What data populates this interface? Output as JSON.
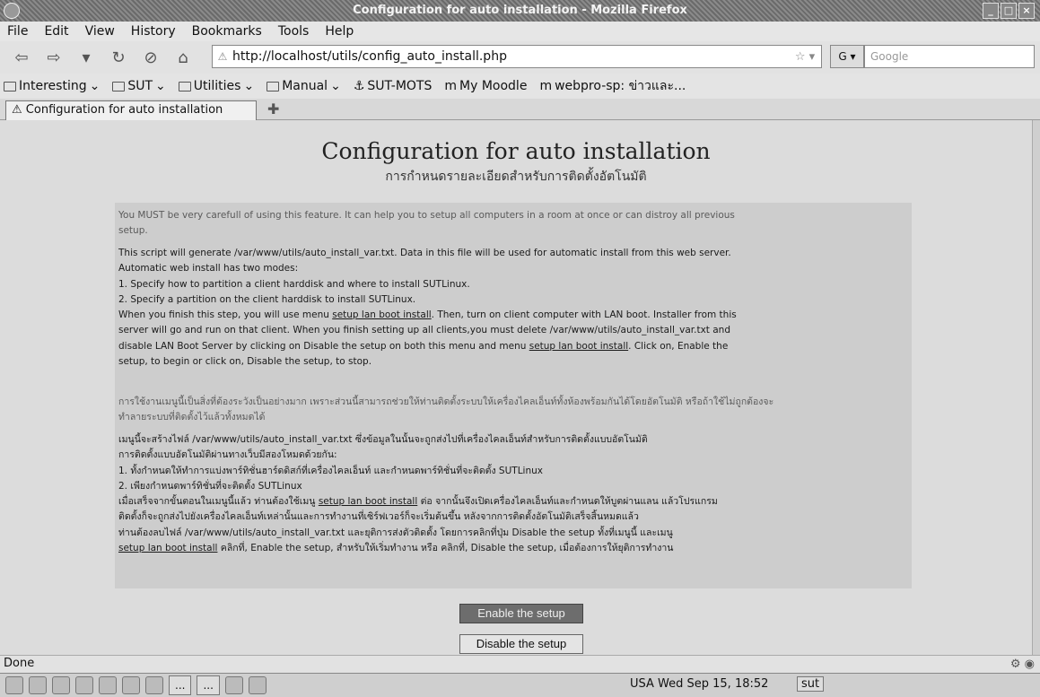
{
  "window": {
    "title": "Configuration for auto installation - Mozilla Firefox"
  },
  "menu": [
    "File",
    "Edit",
    "View",
    "History",
    "Bookmarks",
    "Tools",
    "Help"
  ],
  "nav": {
    "url": "http://localhost/utils/config_auto_install.php",
    "search_placeholder": "Google"
  },
  "bookmarks": [
    "Interesting",
    "SUT",
    "Utilities",
    "Manual",
    "SUT-MOTS",
    "My Moodle",
    "webpro-sp: ข่าวและ..."
  ],
  "tab": {
    "title": "Configuration for auto installation"
  },
  "page": {
    "title": "Configuration for auto installation",
    "subtitle": "การกำหนดรายละเอียดสำหรับการติดตั้งอัตโนมัติ",
    "warning": [
      "You MUST be very carefull of using this feature. It can help you to setup all computers in a room at once or can distroy all previous",
      "setup."
    ],
    "desc_lines": [
      "This script will generate /var/www/utils/auto_install_var.txt. Data in this file will be used for automatic install from this web server.",
      "Automatic web install has two modes:",
      "1. Specify how to partition a client harddisk and where to install SUTLinux.",
      "2. Specify a partition on the client harddisk to install SUTLinux."
    ],
    "desc_link_pre": "When you finish this step, you will use menu ",
    "desc_link_text": "setup lan boot install",
    "desc_link_post": ". Then, turn on client computer with LAN boot. Installer from this",
    "desc_line_6": "server will go and run on that client. When you finish setting up all clients,you must delete /var/www/utils/auto_install_var.txt and",
    "desc_line_7_pre": "disable LAN Boot Server by clicking on Disable the setup on both this menu and menu ",
    "desc_line_7_link": "setup lan boot install",
    "desc_line_7_post": ". Click on, Enable the",
    "desc_line_8": "setup, to begin or click on, Disable the setup, to stop.",
    "thai_warning": [
      "การใช้งานเมนูนี้เป็นสิ่งที่ต้องระวังเป็นอย่างมาก เพราะส่วนนี้สามารถช่วยให้ท่านติดตั้งระบบให้เครื่องไคลเอ็นท์ทั้งห้องพร้อมกันได้โดยอัตโนมัติ หรือถ้าใช้ไม่ถูกต้องจะ",
      "ทำลายระบบที่ติดตั้งไว้แล้วทั้งหมดได้"
    ],
    "thai_lines": [
      "เมนูนี้จะสร้างไฟล์ /var/www/utils/auto_install_var.txt ซึ่งข้อมูลในนั้นจะถูกส่งไปที่เครื่องไคลเอ็นท์สำหรับการติดตั้งแบบอัตโนมัติ",
      "การติดตั้งแบบอัตโนมัติผ่านทางเว็บมีสองโหมดด้วยกัน:",
      "1. ทั้งกำหนดให้ทำการแบ่งพาร์ทิชั่นฮาร์ดดิสก์ที่เครื่องไคลเอ็นท์ และกำหนดพาร์ทิชั่นที่จะติดตั้ง SUTLinux",
      "2. เพียงกำหนดพาร์ทิชั่นที่จะติดตั้ง SUTLinux"
    ],
    "thai_link_pre": "เมื่อเสร็จจากขั้นตอนในเมนูนี้แล้ว ท่านต้องใช้เมนู ",
    "thai_link_text": "setup lan boot install",
    "thai_link_post": " ต่อ จากนั้นจึงเปิดเครื่องไคลเอ็นท์และกำหนดให้บูตผ่านแลน แล้วโปรแกรม",
    "thai_line_6": "ติดตั้งก็จะถูกส่งไปยังเครื่องไคลเอ็นท์เหล่านั้นและการทำงานที่เซิร์ฟเวอร์ก็จะเริ่มต้นขึ้น หลังจากการติดตั้งอัตโนมัติเสร็จสิ้นหมดแล้ว",
    "thai_line_7": "ท่านต้องลบไฟล์ /var/www/utils/auto_install_var.txt และยุติการส่งตัวติดตั้ง โดยการคลิกที่ปุ่ม Disable the setup ทั้งที่เมนูนี้ และเมนู",
    "thai_line_8_link": "setup lan boot install",
    "thai_line_8_post": " คลิกที่, Enable the setup, สำหรับให้เริ่มทำงาน หรือ คลิกที่, Disable the setup, เมื่อต้องการให้ยุติการทำงาน",
    "enable_button": "Enable the setup",
    "disable_button": "Disable the setup"
  },
  "status": {
    "text": "Done"
  },
  "taskbar": {
    "clock": "USA Wed Sep 15, 18:52",
    "user": "sut",
    "task_1": "...",
    "task_2": "..."
  }
}
